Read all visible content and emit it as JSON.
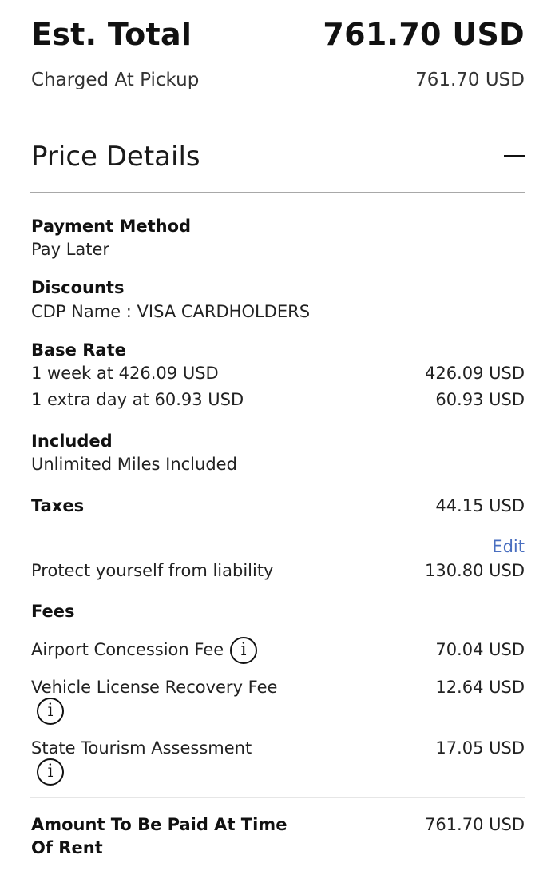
{
  "summary": {
    "est_total_label": "Est. Total",
    "est_total_value": "761.70 USD",
    "charged_label": "Charged At Pickup",
    "charged_value": "761.70 USD"
  },
  "price_details": {
    "title": "Price Details",
    "payment_method": {
      "heading": "Payment Method",
      "value": "Pay Later"
    },
    "discounts": {
      "heading": "Discounts",
      "value": "CDP Name : VISA CARDHOLDERS"
    },
    "base_rate": {
      "heading": "Base Rate",
      "lines": [
        {
          "label": "1 week at 426.09 USD",
          "amount": "426.09 USD"
        },
        {
          "label": "1 extra day at 60.93 USD",
          "amount": "60.93 USD"
        }
      ]
    },
    "included": {
      "heading": "Included",
      "value": "Unlimited Miles Included"
    },
    "taxes": {
      "heading": "Taxes",
      "amount": "44.15 USD"
    },
    "protection": {
      "edit_label": "Edit",
      "label": "Protect yourself from liability",
      "amount": "130.80 USD"
    },
    "fees": {
      "heading": "Fees",
      "items": [
        {
          "label": "Airport Concession Fee",
          "amount": "70.04 USD"
        },
        {
          "label": "Vehicle License Recovery Fee",
          "amount": "12.64 USD"
        },
        {
          "label": "State Tourism Assessment",
          "amount": "17.05 USD"
        }
      ]
    },
    "amount_due": {
      "label_line1": "Amount To Be Paid At Time",
      "label_line2": "Of Rent",
      "amount": "761.70 USD"
    }
  },
  "icons": {
    "info_glyph": "i",
    "collapse": "minus-icon"
  }
}
